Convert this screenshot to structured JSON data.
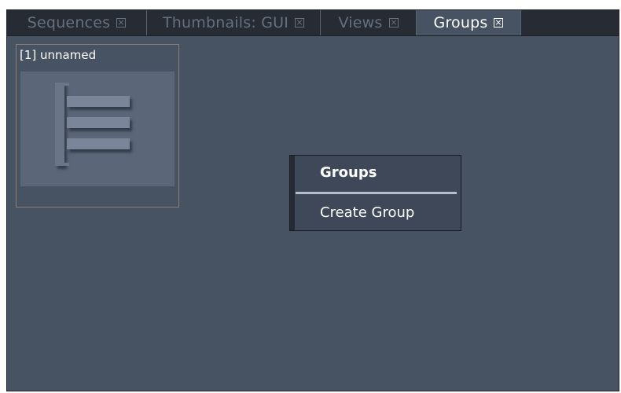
{
  "tabs": [
    {
      "label": "Sequences",
      "icon": "close-icon",
      "active": false
    },
    {
      "label": "Thumbnails: GUI",
      "icon": "close-icon",
      "active": false
    },
    {
      "label": "Views",
      "icon": "close-icon",
      "active": false
    },
    {
      "label": "Groups",
      "icon": "close-icon",
      "active": true
    }
  ],
  "thumbnail": {
    "label": "[1] unnamed",
    "icon": "sequence-list-icon"
  },
  "context_menu": {
    "title": "Groups",
    "items": [
      {
        "label": "Create Group"
      }
    ]
  },
  "colors": {
    "panel_bg": "#475263",
    "tabbar_bg": "#272c34",
    "inactive_tab_text": "#67707f",
    "active_tab_text": "#ffffff",
    "thumb_border": "#8b7f73",
    "menu_bg": "#3f4858"
  }
}
